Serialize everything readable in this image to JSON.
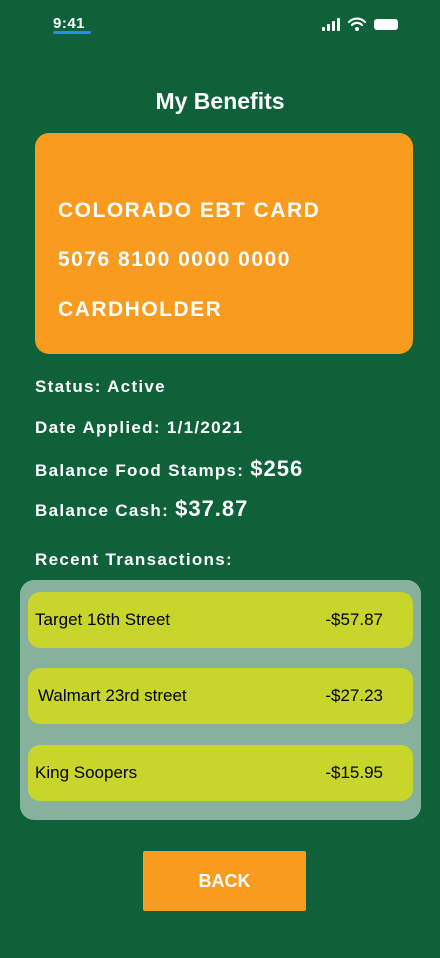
{
  "status_bar": {
    "time": "9:41",
    "icons": [
      "signal-icon",
      "wifi-icon",
      "battery-icon"
    ]
  },
  "header": {
    "title": "My Benefits"
  },
  "card": {
    "name": "COLORADO EBT CARD",
    "number": "5076 8100 0000 0000",
    "holder": "CARDHOLDER"
  },
  "info": {
    "status": "Status: Active",
    "date_applied": "Date Applied: 1/1/2021",
    "food_stamps_label": "Balance Food Stamps:",
    "food_stamps_value": "$256",
    "cash_label": "Balance Cash:",
    "cash_value": "$37.87",
    "recent_label": "Recent Transactions:"
  },
  "transactions": [
    {
      "name": "Target 16th Street",
      "amount": "-$57.87"
    },
    {
      "name": "Walmart 23rd street",
      "amount": "-$27.23"
    },
    {
      "name": "King Soopers",
      "amount": "-$15.95"
    }
  ],
  "back_label": "BACK",
  "colors": {
    "background": "#0f613a",
    "accent": "#f89b1e",
    "transaction_panel": "#87b19d",
    "transaction_row": "#c8d52b"
  }
}
